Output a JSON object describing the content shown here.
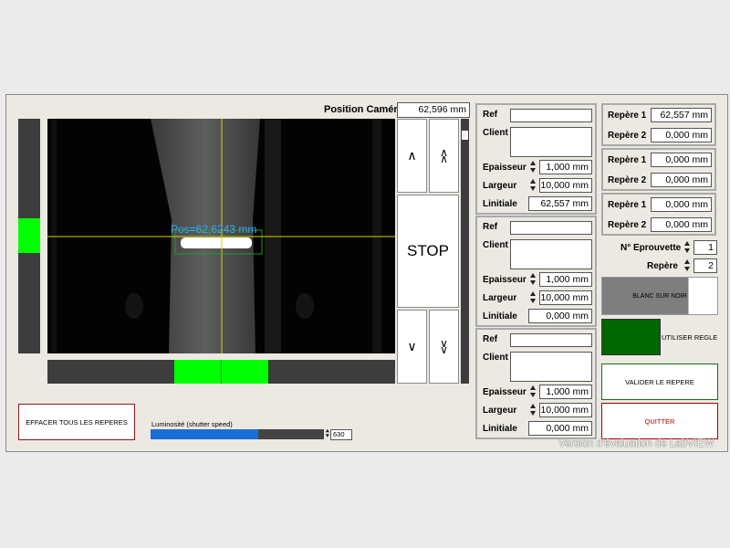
{
  "camera": {
    "position_label": "Position Caméra",
    "position_value": "62,596 mm",
    "overlay_text": "Pos=62,6243 mm"
  },
  "nav": {
    "up_label": "∧",
    "up_fast_label": "∧∧",
    "stop_label": "STOP",
    "down_label": "∨",
    "down_fast_label": "∨∨"
  },
  "specimens": [
    {
      "ref_label": "Ref",
      "client_label": "Client",
      "epaisseur_label": "Epaisseur",
      "epaisseur": "1,000 mm",
      "largeur_label": "Largeur",
      "largeur": "10,000 mm",
      "linitiale_label": "Linitiale",
      "linitiale": "62,557 mm"
    },
    {
      "ref_label": "Ref",
      "client_label": "Client",
      "epaisseur_label": "Epaisseur",
      "epaisseur": "1,000 mm",
      "largeur_label": "Largeur",
      "largeur": "10,000 mm",
      "linitiale_label": "Linitiale",
      "linitiale": "0,000 mm"
    },
    {
      "ref_label": "Ref",
      "client_label": "Client",
      "epaisseur_label": "Epaisseur",
      "epaisseur": "1,000 mm",
      "largeur_label": "Largeur",
      "largeur": "10,000 mm",
      "linitiale_label": "Linitiale",
      "linitiale": "0,000 mm"
    }
  ],
  "reperes": [
    {
      "r1_label": "Repère 1",
      "r1": "62,557 mm",
      "r2_label": "Repère 2",
      "r2": "0,000 mm"
    },
    {
      "r1_label": "Repère 1",
      "r1": "0,000 mm",
      "r2_label": "Repère 2",
      "r2": "0,000 mm"
    },
    {
      "r1_label": "Repère 1",
      "r1": "0,000 mm",
      "r2_label": "Repère 2",
      "r2": "0,000 mm"
    }
  ],
  "eprouvette": {
    "label": "N° Eprouvette",
    "value": "1"
  },
  "repere_sel": {
    "label": "Repère",
    "value": "2"
  },
  "buttons": {
    "blanc_sur_noir": "BLANC SUR NOIR",
    "utiliser_regle": "UTILISER REGLE",
    "valider": "VALIDER LE REPERE",
    "quitter": "QUITTER",
    "effacer": "EFFACER TOUS LES REPERES"
  },
  "luminosite": {
    "label": "Luminosité (shutter speed)",
    "value": "630",
    "level_fraction": 0.62
  },
  "watermark": "Version d'évaluation de LabVIEW",
  "colors": {
    "accent_green": "#00ff00",
    "dark_green": "#006600",
    "quit_red": "#b00000",
    "slider_blue": "#1a6fd6",
    "overlay_cyan": "#35a7ff",
    "crosshair": "#d2d200"
  }
}
